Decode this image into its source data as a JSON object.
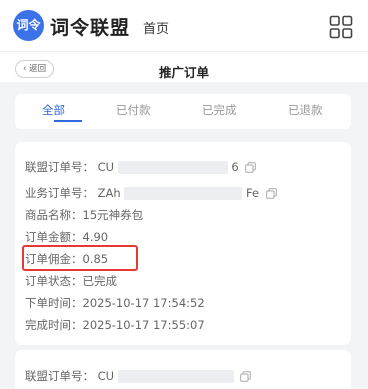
{
  "header": {
    "logo_text": "词令",
    "brand": "词令联盟",
    "home": "首页",
    "grid_icon": "grid-icon"
  },
  "subheader": {
    "back": "‹ 返回",
    "title": "推广订单"
  },
  "tabs": [
    {
      "label": "全部",
      "active": true
    },
    {
      "label": "已付款",
      "active": false
    },
    {
      "label": "已完成",
      "active": false
    },
    {
      "label": "已退款",
      "active": false
    }
  ],
  "orders": [
    {
      "union_order_label": "联盟订单号：",
      "union_order_prefix": "CU",
      "union_order_suffix": "6",
      "business_order_label": "业务订单号：",
      "business_order_prefix": "ZAh",
      "business_order_suffix": "Fe",
      "product_label": "商品名称：",
      "product": "15元神券包",
      "amount_label": "订单金额：",
      "amount": "4.90",
      "commission_label": "订单佣金：",
      "commission": "0.85",
      "status_label": "订单状态：",
      "status": "已完成",
      "order_time_label": "下单时间：",
      "order_time": "2025-10-17 17:54:52",
      "complete_time_label": "完成时间：",
      "complete_time": "2025-10-17 17:55:07"
    },
    {
      "union_order_label": "联盟订单号：",
      "union_order_prefix": "CU"
    }
  ],
  "colors": {
    "accent": "#2f68e0",
    "highlight": "#e53935",
    "logo": "#3b72e8"
  }
}
